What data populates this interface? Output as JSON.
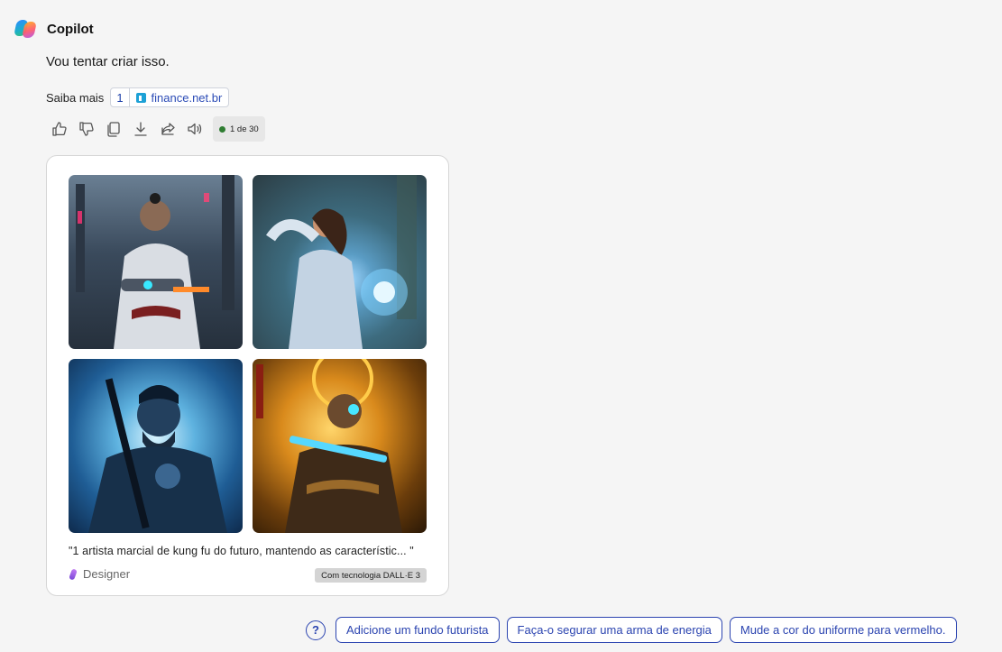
{
  "header": {
    "title": "Copilot",
    "logo_icon": "copilot-logo-icon"
  },
  "message": {
    "text": "Vou tentar criar isso."
  },
  "learn_more": {
    "label": "Saiba mais",
    "citations": [
      {
        "number": "1",
        "site": "finance.net.br",
        "icon": "finance-favicon-icon"
      }
    ]
  },
  "toolbar": {
    "icons": [
      "thumbs-up-icon",
      "thumbs-down-icon",
      "copy-icon",
      "download-icon",
      "share-icon",
      "speaker-icon"
    ],
    "counter": "1 de 30",
    "counter_dot_color": "#2f7d32"
  },
  "image_card": {
    "images": [
      {
        "name": "generated-image-1"
      },
      {
        "name": "generated-image-2"
      },
      {
        "name": "generated-image-3"
      },
      {
        "name": "generated-image-4"
      }
    ],
    "caption": "\"1 artista marcial de kung fu do futuro, mantendo as característic... \"",
    "brand": "Designer",
    "badge": "Com tecnologia DALL·E 3"
  },
  "suggestions": {
    "help_icon": "question-circle-icon",
    "chips": [
      "Adicione um fundo futurista",
      "Faça-o segurar uma arma de energia",
      "Mude a cor do uniforme para vermelho."
    ],
    "accent_color": "#2b44b0"
  }
}
